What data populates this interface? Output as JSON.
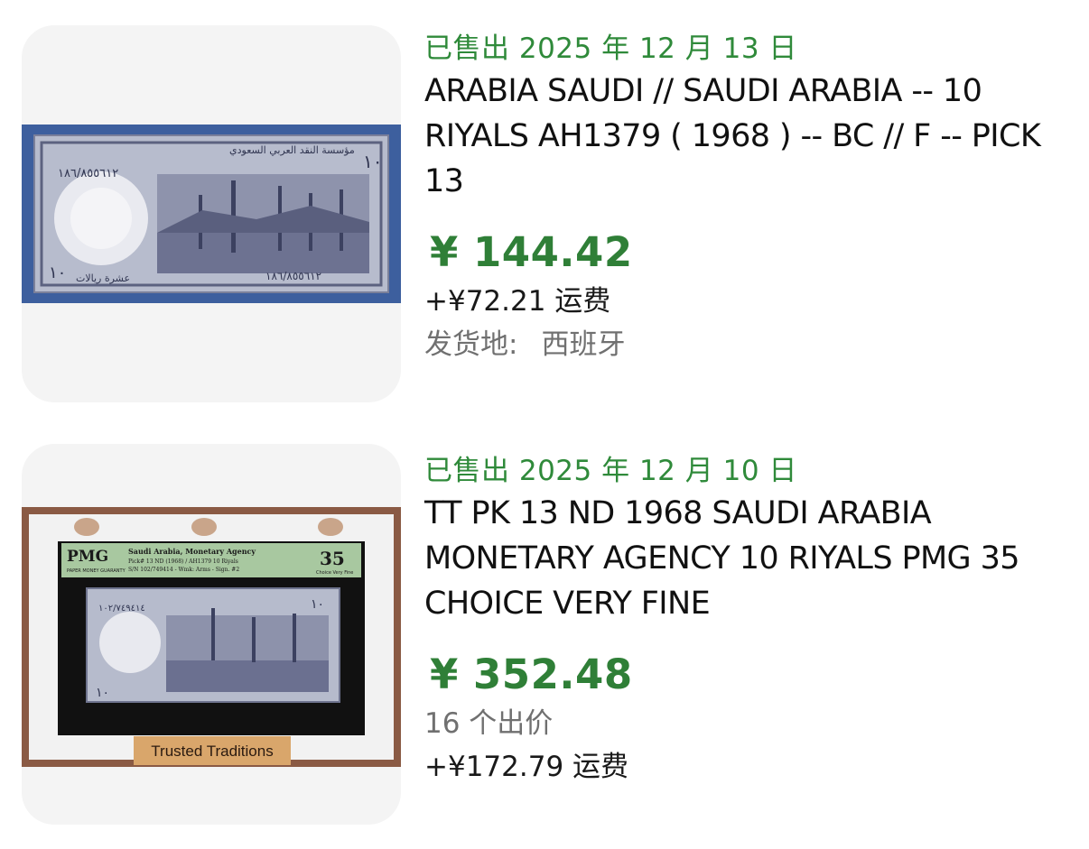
{
  "listings": [
    {
      "sold_date": "已售出 2025 年 12 月 13 日",
      "title": "ARABIA SAUDI // SAUDI ARABIA -- 10 RIYALS AH1379 ( 1968 ) -- BC // F -- PICK 13",
      "price": "¥ 144.42",
      "shipping": "+¥72.21 运费",
      "location_label": "发货地:",
      "location_value": "西班牙",
      "image": {
        "alt": "Saudi Arabia 10 Riyals banknote",
        "banknote_text_1": "١٠",
        "banknote_serial": "١٨٦/٨٥٥٦١٢",
        "banknote_arabic": "مؤسسة النقد العربي السعودي",
        "banknote_word": "عشرة ريالات"
      }
    },
    {
      "sold_date": "已售出 2025 年 12 月 10 日",
      "title": "TT PK 13 ND 1968 SAUDI ARABIA MONETARY AGENCY 10 RIYALS PMG 35 CHOICE VERY FINE",
      "price": "¥ 352.48",
      "bids": "16 个出价",
      "shipping": "+¥172.79 运费",
      "image": {
        "alt": "PMG graded Saudi Arabia 10 Riyals banknote",
        "pmg_logo": "PMG",
        "pmg_line1": "Saudi Arabia, Monetary Agency",
        "pmg_line2": "Pick# 13  ND (1968) / AH1379  10 Riyals",
        "pmg_line3": "S/N 102/749414 - Wmk: Arms - Sign. #2",
        "pmg_guarantee": "PAPER MONEY GUARANTY",
        "pmg_grade": "35",
        "pmg_grade_text": "Choice Very Fine",
        "banner": "Trusted Traditions",
        "banknote_text_1": "١٠",
        "banknote_serial": "١٠٢/٧٤٩٤١٤"
      }
    }
  ],
  "colors": {
    "sold_green": "#2f8a3a",
    "price_green": "#2f7f37",
    "muted_gray": "#707070"
  }
}
